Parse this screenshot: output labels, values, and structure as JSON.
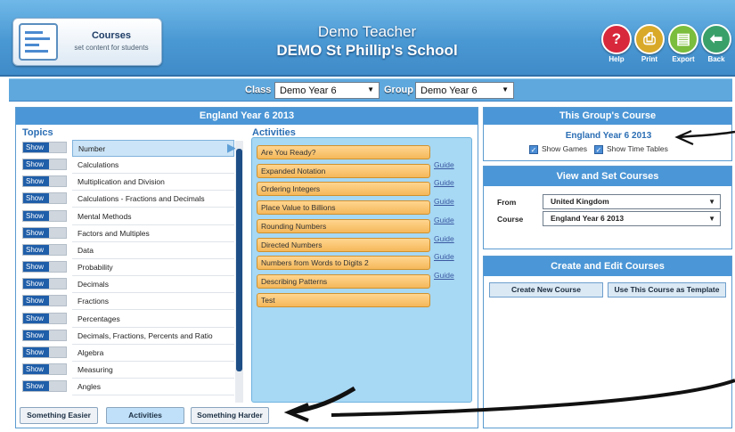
{
  "header": {
    "course_title": "Courses",
    "course_subtitle": "set content for students",
    "teacher": "Demo Teacher",
    "school": "DEMO St Phillip's School",
    "buttons": [
      {
        "label": "Help",
        "icon": "question-icon",
        "color": "#d8283c"
      },
      {
        "label": "Print",
        "icon": "printer-icon",
        "color": "#d9a92a"
      },
      {
        "label": "Export",
        "icon": "document-icon",
        "color": "#7bbd3c"
      },
      {
        "label": "Back",
        "icon": "arrow-left-icon",
        "color": "#3aa06a"
      }
    ]
  },
  "toolbar": {
    "class_label": "Class",
    "class_value": "Demo Year 6",
    "group_label": "Group",
    "group_value": "Demo Year 6"
  },
  "left_panel": {
    "title": "England Year 6 2013",
    "topics_heading": "Topics",
    "activities_heading": "Activities",
    "show_label": "Show",
    "topics": [
      "Number",
      "Calculations",
      "Multiplication and Division",
      "Calculations - Fractions and Decimals",
      "Mental Methods",
      "Factors and Multiples",
      "Data",
      "Probability",
      "Decimals",
      "Fractions",
      "Percentages",
      "Decimals, Fractions, Percents and Ratio",
      "Algebra",
      "Measuring",
      "Angles"
    ],
    "activities": [
      {
        "name": "Are You Ready?",
        "guide": ""
      },
      {
        "name": "Expanded Notation",
        "guide": "Guide"
      },
      {
        "name": "Ordering Integers",
        "guide": "Guide"
      },
      {
        "name": "Place Value to Billions",
        "guide": "Guide"
      },
      {
        "name": "Rounding Numbers",
        "guide": "Guide"
      },
      {
        "name": "Directed Numbers",
        "guide": "Guide"
      },
      {
        "name": "Numbers from Words to Digits 2",
        "guide": "Guide"
      },
      {
        "name": "Describing Patterns",
        "guide": "Guide"
      },
      {
        "name": "Test",
        "guide": ""
      }
    ],
    "bottom_buttons": [
      "Something Easier",
      "Activities",
      "Something Harder"
    ]
  },
  "group_course": {
    "title": "This Group's Course",
    "course_name": "England Year 6 2013",
    "show_games": "Show Games",
    "show_time_tables": "Show Time Tables"
  },
  "view_set": {
    "title": "View and Set Courses",
    "from_label": "From",
    "from_value": "United Kingdom",
    "course_label": "Course",
    "course_value": "England Year 6 2013"
  },
  "create_edit": {
    "title": "Create and Edit Courses",
    "create_new": "Create New Course",
    "use_template": "Use This Course as Template"
  },
  "colors": {
    "header_blue": "#4a98d3",
    "panel_header": "#4b96d6",
    "activity_orange": "#f5b85a",
    "activities_bg": "#a7d8f4"
  }
}
